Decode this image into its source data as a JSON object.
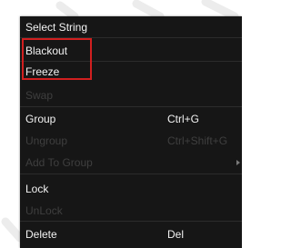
{
  "colors": {
    "menu_background": "#161616",
    "text_enabled": "#f2f2f2",
    "text_disabled": "#3f3f3f",
    "highlight": "#d11f1f"
  },
  "menu": {
    "items": [
      {
        "label": "Select String",
        "shortcut": "",
        "enabled": true
      },
      {
        "label": "Blackout",
        "shortcut": "",
        "enabled": true
      },
      {
        "label": "Freeze",
        "shortcut": "",
        "enabled": true
      },
      {
        "label": "Swap",
        "shortcut": "",
        "enabled": false
      },
      {
        "label": "Group",
        "shortcut": "Ctrl+G",
        "enabled": true
      },
      {
        "label": "Ungroup",
        "shortcut": "Ctrl+Shift+G",
        "enabled": false
      },
      {
        "label": "Add To Group",
        "shortcut": "",
        "enabled": false,
        "submenu_icon": "chevron-right-icon"
      },
      {
        "label": "Lock",
        "shortcut": "",
        "enabled": true
      },
      {
        "label": "UnLock",
        "shortcut": "",
        "enabled": false
      },
      {
        "label": "Delete",
        "shortcut": "Del",
        "enabled": true
      }
    ]
  }
}
